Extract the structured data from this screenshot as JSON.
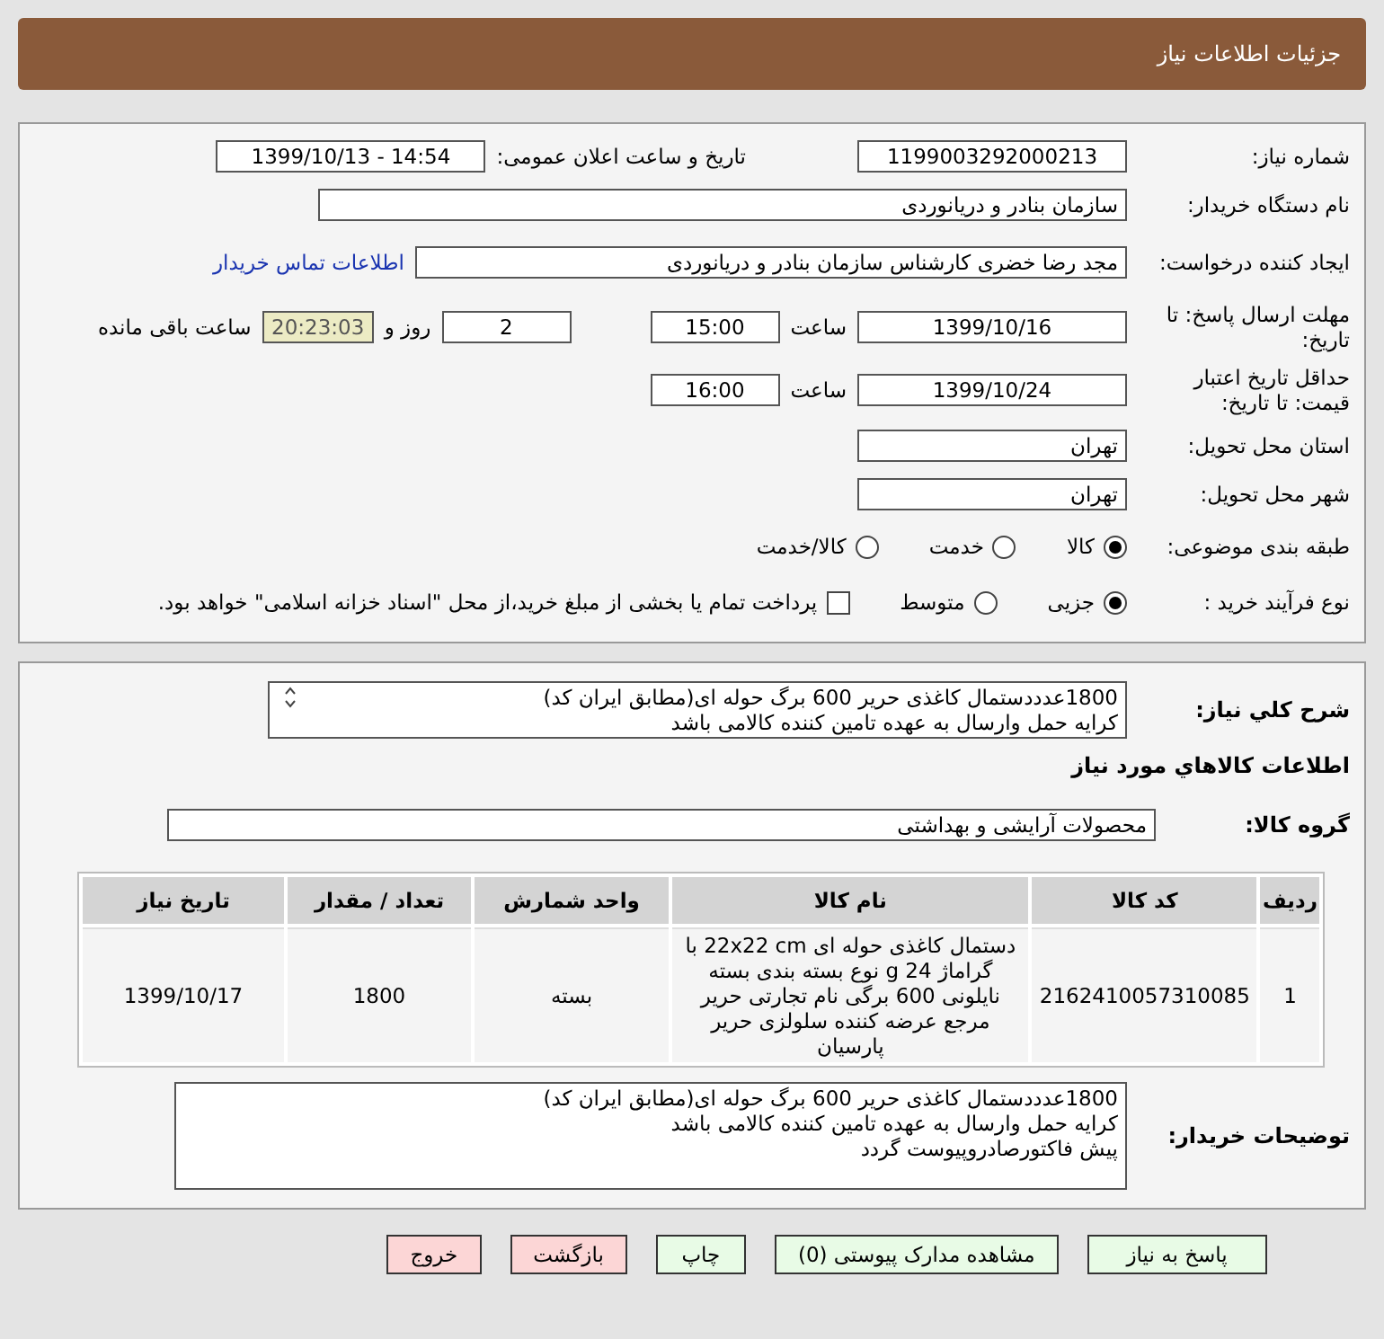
{
  "header": {
    "title": "جزئیات اطلاعات نیاز"
  },
  "details": {
    "need_number": {
      "label": "شماره نیاز:",
      "value": "1199003292000213"
    },
    "announce": {
      "label": "تاریخ و ساعت اعلان عمومی:",
      "value": "1399/10/13 - 14:54"
    },
    "buyer_org": {
      "label": "نام دستگاه خریدار:",
      "value": "سازمان بنادر و دریانوردی"
    },
    "requester": {
      "label": "ایجاد کننده درخواست:",
      "value": "مجد رضا خضری کارشناس سازمان بنادر و دریانوردی",
      "link": "اطلاعات تماس خریدار"
    },
    "deadline": {
      "label": "مهلت ارسال پاسخ: تا تاریخ:",
      "date": "1399/10/16",
      "time_label": "ساعت",
      "time": "15:00",
      "days": "2",
      "days_label": "روز و",
      "remaining": "20:23:03",
      "remaining_label": "ساعت باقی مانده"
    },
    "validity": {
      "label": "حداقل تاریخ اعتبار قیمت: تا تاریخ:",
      "date": "1399/10/24",
      "time_label": "ساعت",
      "time": "16:00"
    },
    "province": {
      "label": "استان محل تحویل:",
      "value": "تهران"
    },
    "city": {
      "label": "شهر محل تحویل:",
      "value": "تهران"
    },
    "category": {
      "label": "طبقه بندی موضوعی:",
      "options": [
        {
          "label": "کالا",
          "selected": true
        },
        {
          "label": "خدمت",
          "selected": false
        },
        {
          "label": "کالا/خدمت",
          "selected": false
        }
      ]
    },
    "process": {
      "label": "نوع فرآیند خرید :",
      "options": [
        {
          "label": "جزیی",
          "selected": true
        },
        {
          "label": "متوسط",
          "selected": false
        }
      ],
      "treasury": {
        "label": "پرداخت تمام یا بخشی از مبلغ خرید،از محل \"اسناد خزانه اسلامی\" خواهد بود.",
        "checked": false
      }
    }
  },
  "items": {
    "summary": {
      "label": "شرح کلي نیاز:",
      "value": "1800عدددستمال کاغذی حریر 600 برگ حوله ای(مطابق ایران کد)\nکرایه حمل وارسال به عهده تامین کننده کالامی باشد"
    },
    "section_title": "اطلاعات کالاهاي مورد نیاز",
    "group": {
      "label": "گروه کالا:",
      "value": "محصولات آرایشی و بهداشتی"
    },
    "table": {
      "columns": [
        "ردیف",
        "کد کالا",
        "نام کالا",
        "واحد شمارش",
        "تعداد / مقدار",
        "تاریخ نیاز"
      ],
      "rows": [
        [
          "1",
          "2162410057310085",
          "دستمال کاغذی حوله ای 22x22 cm با گراماژ 24 g نوع بسته بندی بسته نایلونی 600 برگی نام تجارتی حریر مرجع عرضه کننده سلولزی حریر پارسیان",
          "بسته",
          "1800",
          "1399/10/17"
        ]
      ]
    },
    "buyer_notes": {
      "label": "توضیحات خریدار:",
      "value": "1800عدددستمال کاغذی حریر 600 برگ حوله ای(مطابق ایران کد)\nکرایه حمل وارسال به عهده تامین کننده کالامی باشد\nپیش فاکتورصادروپیوست گردد"
    }
  },
  "actions": [
    {
      "label": "پاسخ به نیاز",
      "kind": "primary"
    },
    {
      "label": "مشاهده مدارک پیوستی (0)",
      "kind": "primary"
    },
    {
      "label": "چاپ",
      "kind": "primary"
    },
    {
      "label": "بازگشت",
      "kind": "danger"
    },
    {
      "label": "خروج",
      "kind": "danger"
    }
  ]
}
